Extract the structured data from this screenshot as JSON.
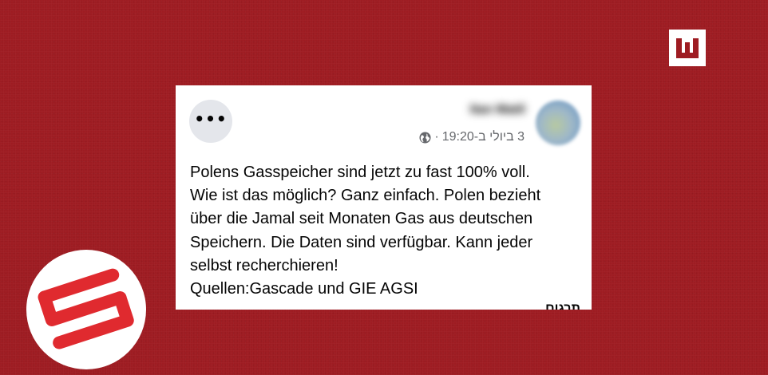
{
  "post": {
    "author_name": "Itan Matil",
    "timestamp": "3 ביולי ב-19:20",
    "separator": "·",
    "text": "Polens Gasspeicher sind jetzt zu fast 100% voll.\nWie ist das möglich? Ganz einfach. Polen bezieht\nüber die Jamal seit Monaten Gas aus deutschen\nSpeichern. Die Daten sind verfügbar. Kann jeder\nselbst recherchieren!\nQuellen:Gascade und GIE AGSI",
    "cut_off_text": "תרגום"
  },
  "icons": {
    "more": "more-options-icon",
    "privacy": "globe-icon"
  },
  "colors": {
    "background": "#9e1c22",
    "accent_red": "#e02a2f",
    "card": "#ffffff",
    "meta_text": "#65676b"
  }
}
